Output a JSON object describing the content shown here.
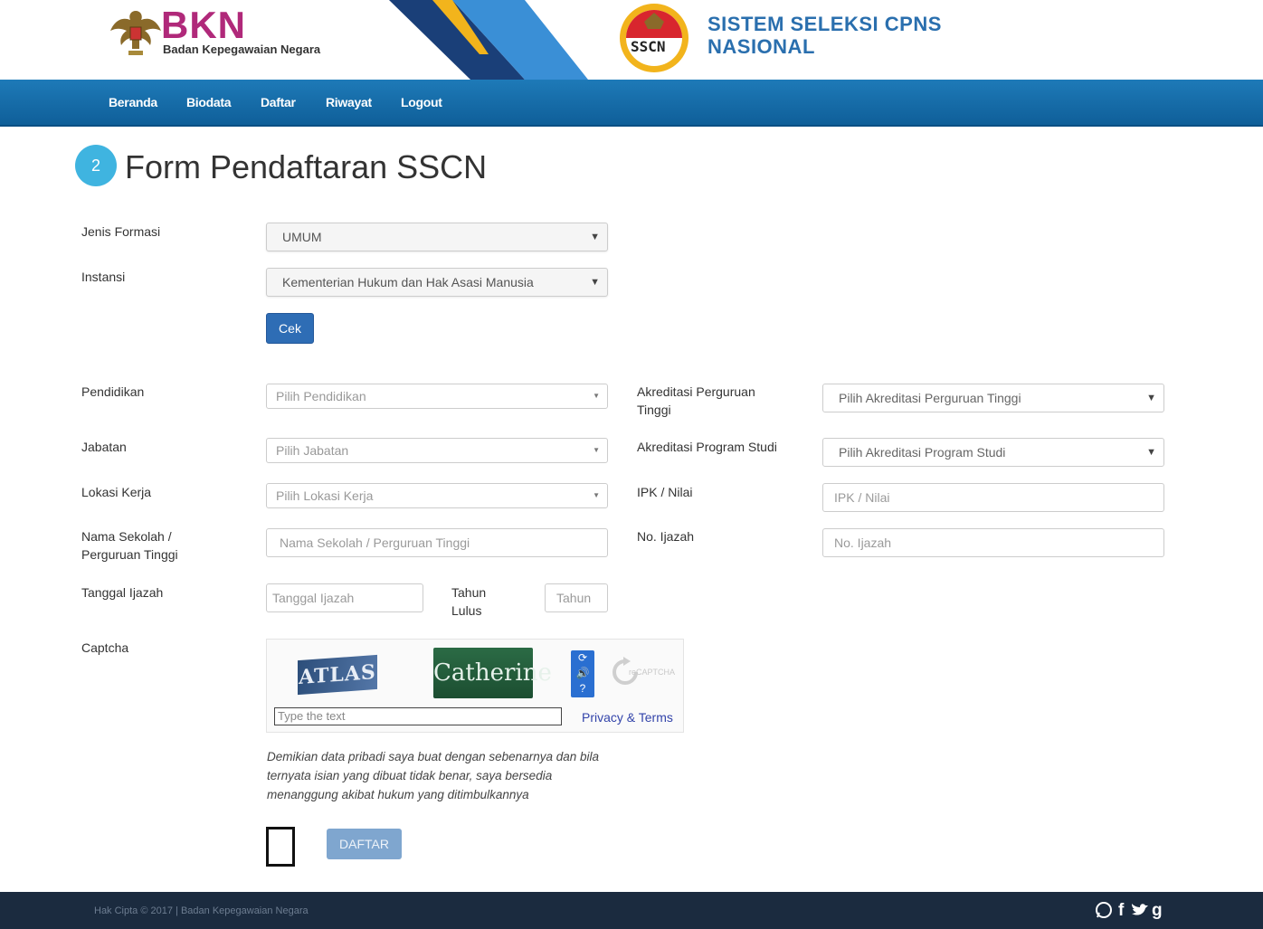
{
  "header": {
    "bkn_title": "BKN",
    "bkn_subtitle": "Badan Kepegawaian Negara",
    "sscn_logo_text": "SSCN",
    "sscn_title_line1": "SISTEM SELEKSI CPNS",
    "sscn_title_line2": "NASIONAL"
  },
  "nav": {
    "items": [
      "Beranda",
      "Biodata",
      "Daftar",
      "Riwayat",
      "Logout"
    ]
  },
  "page": {
    "step_number": "2",
    "title": "Form Pendaftaran SSCN"
  },
  "form": {
    "jenis_formasi": {
      "label": "Jenis Formasi",
      "value": "UMUM"
    },
    "instansi": {
      "label": "Instansi",
      "value": "Kementerian Hukum dan Hak Asasi Manusia"
    },
    "cek_button": "Cek",
    "pendidikan": {
      "label": "Pendidikan",
      "placeholder": "Pilih Pendidikan"
    },
    "jabatan": {
      "label": "Jabatan",
      "placeholder": "Pilih Jabatan"
    },
    "lokasi_kerja": {
      "label": "Lokasi Kerja",
      "placeholder": "Pilih Lokasi Kerja"
    },
    "nama_sekolah": {
      "label_line1": "Nama Sekolah /",
      "label_line2": "Perguruan Tinggi",
      "placeholder": "Nama Sekolah / Perguruan Tinggi"
    },
    "tanggal_ijazah": {
      "label": "Tanggal Ijazah",
      "placeholder": "Tanggal Ijazah"
    },
    "tahun_lulus": {
      "label_line1": "Tahun",
      "label_line2": "Lulus",
      "placeholder": "Tahun"
    },
    "akreditasi_pt": {
      "label_line1": "Akreditasi Perguruan",
      "label_line2": "Tinggi",
      "placeholder": "Pilih Akreditasi Perguruan Tinggi"
    },
    "akreditasi_prodi": {
      "label": "Akreditasi Program Studi",
      "placeholder": "Pilih Akreditasi Program Studi"
    },
    "ipk": {
      "label": "IPK / Nilai",
      "placeholder": "IPK / Nilai"
    },
    "no_ijazah": {
      "label": "No. Ijazah",
      "placeholder": "No. Ijazah"
    },
    "captcha": {
      "label": "Captcha",
      "word1": "ATLAS",
      "word2": "Catherine",
      "input_placeholder": "Type the text",
      "privacy_link": "Privacy & Terms",
      "recaptcha_text": "reCAPTCHA"
    },
    "statement": "Demikian data pribadi saya buat dengan sebenarnya dan bila ternyata isian yang dibuat tidak benar, saya bersedia menanggung akibat hukum yang ditimbulkannya",
    "daftar_button": "DAFTAR"
  },
  "footer": {
    "copyright": "Hak Cipta © 2017 | Badan Kepegawaian Negara",
    "social_icons": [
      "whatsapp-icon",
      "facebook-icon",
      "twitter-icon",
      "google-plus-icon"
    ]
  },
  "colors": {
    "nav_blue": "#1e7ab8",
    "bkn_magenta": "#b0297a",
    "sscn_blue": "#2a6fae",
    "button_blue": "#2e6db5",
    "footer_dark": "#1b2b3f",
    "step_circle": "#3fb4e0"
  }
}
